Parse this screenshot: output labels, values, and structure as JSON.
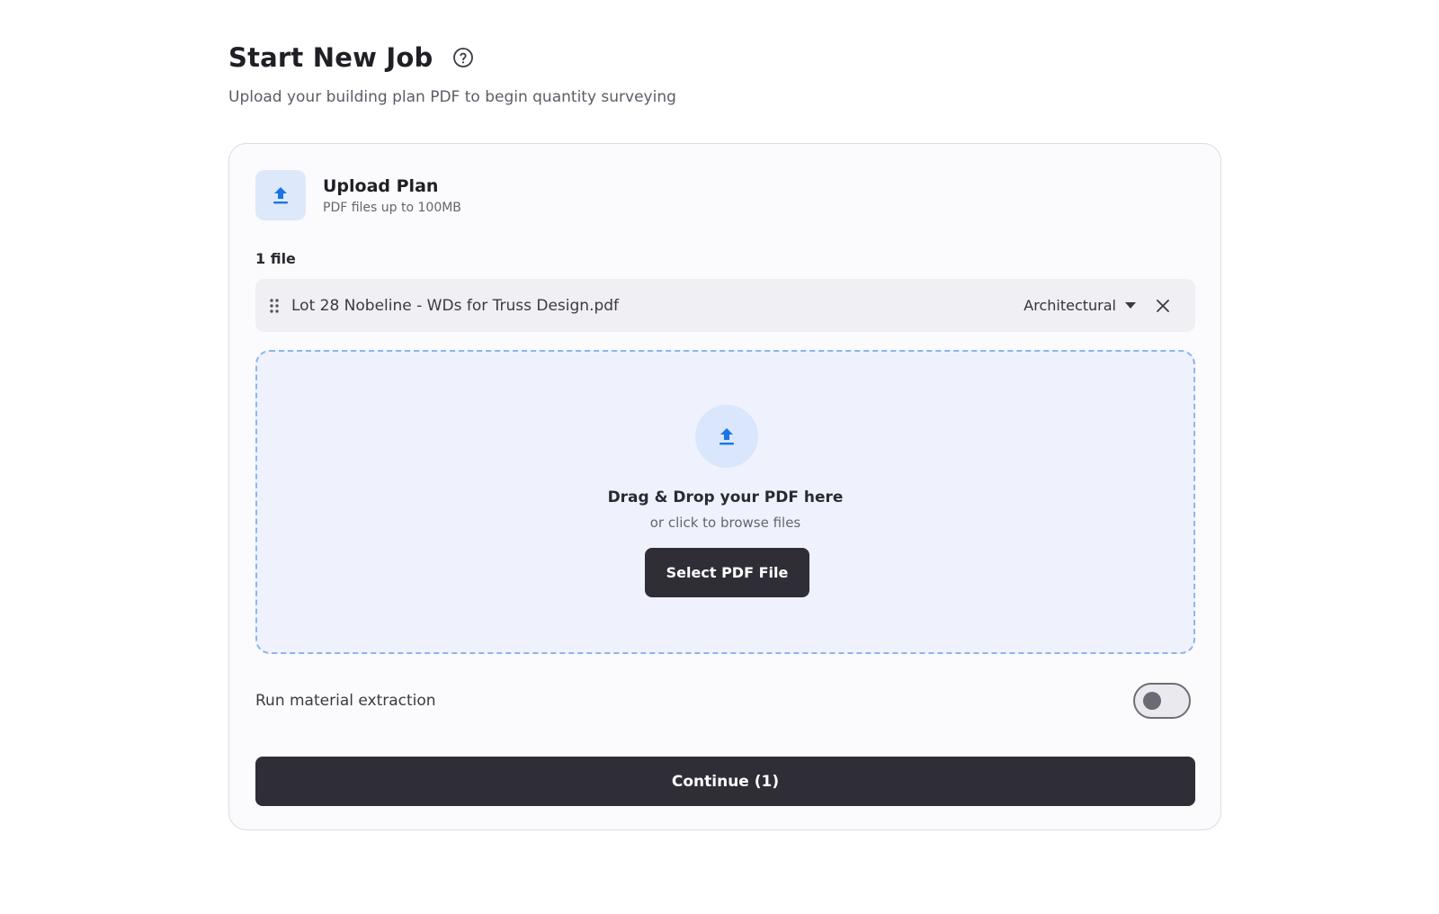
{
  "header": {
    "title": "Start New Job",
    "help_icon": "help-circle-icon",
    "subtitle": "Upload your building plan PDF to begin quantity surveying"
  },
  "upload_card": {
    "icon": "upload-icon",
    "title": "Upload Plan",
    "subtitle": "PDF files up to 100MB",
    "file_count": "1 file",
    "files": [
      {
        "name": "Lot 28 Nobeline - WDs for Truss Design.pdf",
        "type": "Architectural",
        "drag_icon": "drag-handle-icon",
        "remove_icon": "close-icon"
      }
    ],
    "dropzone": {
      "icon": "upload-icon",
      "title": "Drag & Drop your PDF here",
      "subtitle": "or click to browse files",
      "button_label": "Select PDF File"
    },
    "material_extraction": {
      "label": "Run material extraction",
      "enabled": false
    },
    "continue_label": "Continue (1)"
  },
  "colors": {
    "accent_blue": "#1a73e8",
    "dark_button": "#2f2e36",
    "dropzone_border": "#8ab6ee",
    "dropzone_bg": "#eff2fd"
  }
}
